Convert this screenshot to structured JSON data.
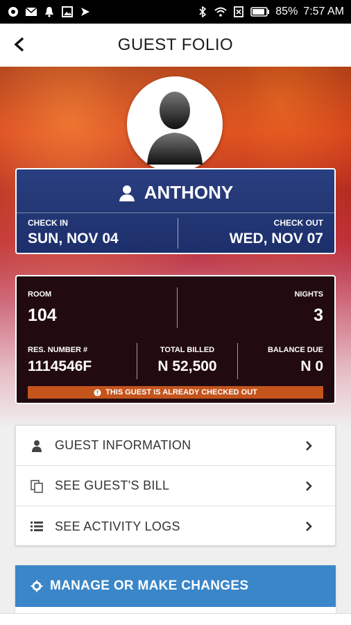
{
  "status_bar": {
    "left_icons": [
      "chrome-icon",
      "mail-icon",
      "notification-icon",
      "image-icon",
      "mail-forward-icon"
    ],
    "right_icons": [
      "bluetooth-icon",
      "wifi-icon",
      "data-icon",
      "battery-icon"
    ],
    "battery": "85%",
    "time": "7:57 AM"
  },
  "appbar": {
    "title": "GUEST FOLIO",
    "back_icon": "chevron-left-icon"
  },
  "guest": {
    "name": "ANTHONY",
    "check_in_label": "CHECK IN",
    "check_in_value": "SUN, NOV 04",
    "check_out_label": "CHECK OUT",
    "check_out_value": "WED, NOV 07"
  },
  "stay": {
    "room_label": "ROOM",
    "room_value": "104",
    "nights_label": "NIGHTS",
    "nights_value": "3",
    "res_label": "RES. NUMBER #",
    "res_value": "1114546F",
    "billed_label": "TOTAL BILLED",
    "billed_value": "N 52,500",
    "balance_label": "BALANCE DUE",
    "balance_value": "N 0",
    "notice": "THIS GUEST IS ALREADY CHECKED OUT"
  },
  "menu": {
    "items": [
      {
        "label": "GUEST INFORMATION",
        "icon": "person-icon"
      },
      {
        "label": "SEE GUEST'S BILL",
        "icon": "copy-icon"
      },
      {
        "label": "SEE ACTIVITY LOGS",
        "icon": "list-icon"
      }
    ]
  },
  "manage": {
    "label": "MANAGE OR MAKE CHANGES",
    "icon": "gear-icon"
  },
  "colors": {
    "accent_blue": "#3a86c8",
    "card_blue": "#1d2f6b",
    "card_dark": "#220b10",
    "warning": "#c4541c"
  }
}
